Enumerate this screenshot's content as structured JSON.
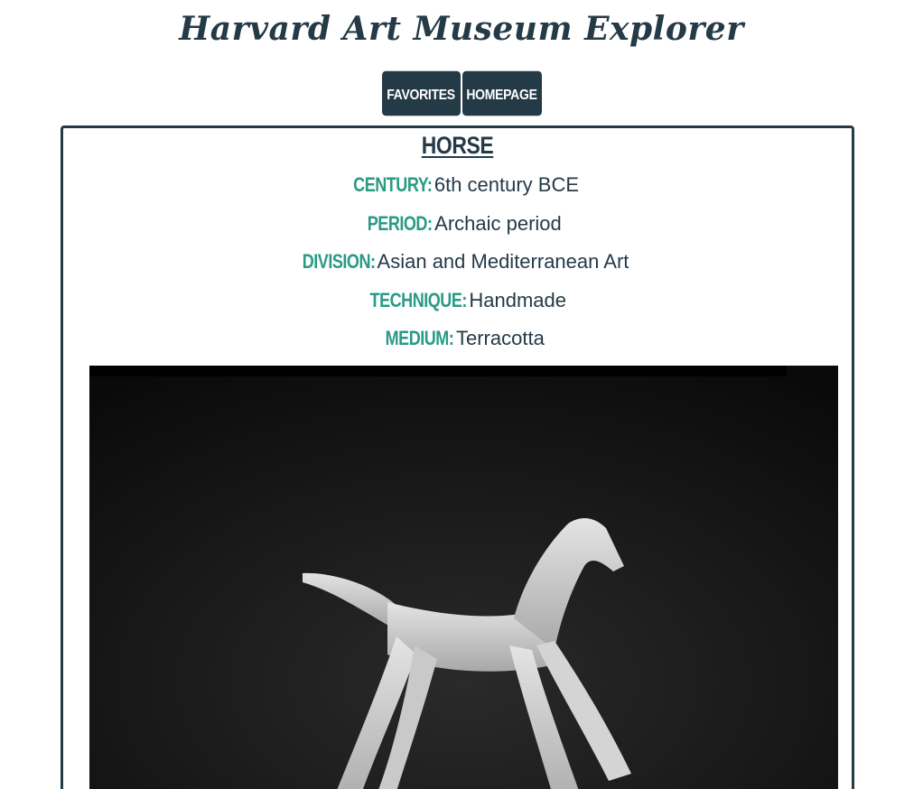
{
  "site": {
    "title": "Harvard Art Museum Explorer"
  },
  "nav": {
    "favorites_label": "FAVORITES",
    "homepage_label": "HOMEPAGE"
  },
  "artwork": {
    "title": "HORSE",
    "fields": [
      {
        "label": "CENTURY:",
        "value": "6th century BCE"
      },
      {
        "label": "PERIOD:",
        "value": "Archaic period"
      },
      {
        "label": "DIVISION:",
        "value": "Asian and Mediterranean Art"
      },
      {
        "label": "TECHNIQUE:",
        "value": "Handmade"
      },
      {
        "label": "MEDIUM:",
        "value": "Terracotta"
      }
    ]
  },
  "colors": {
    "primary": "#243a47",
    "accent": "#2a9a86"
  }
}
